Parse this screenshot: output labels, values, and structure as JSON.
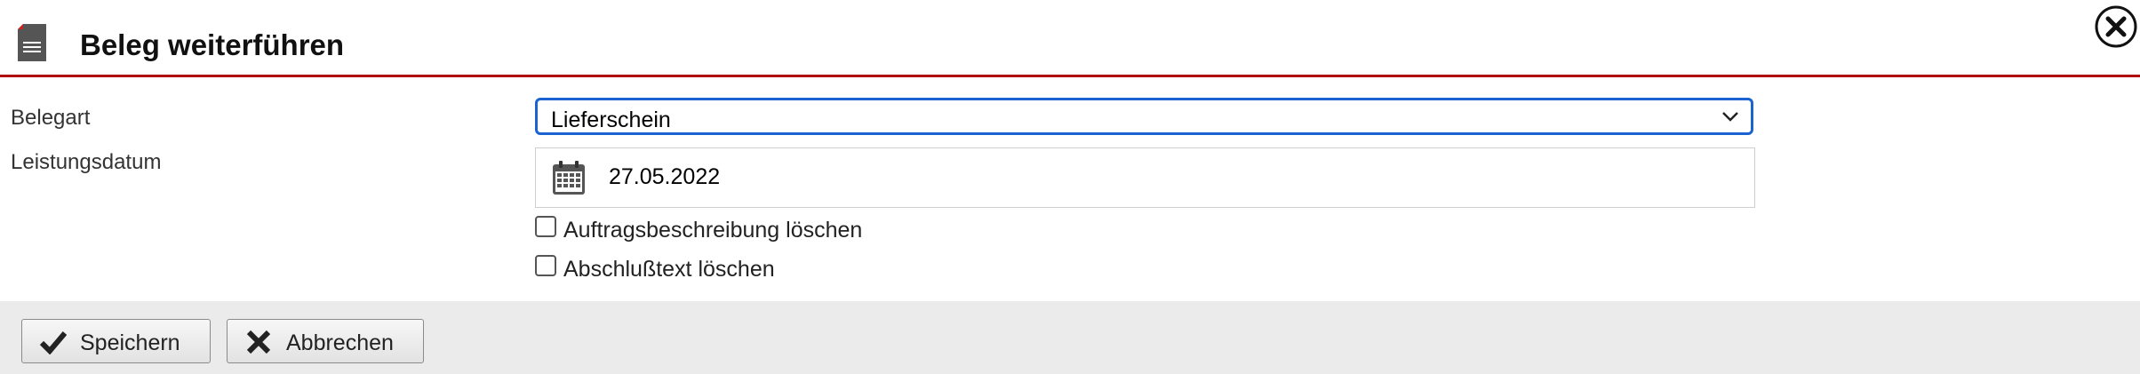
{
  "dialog": {
    "title": "Beleg weiterführen",
    "header_icon": "document-icon",
    "close_icon": "close-icon"
  },
  "form": {
    "belegart": {
      "label": "Belegart",
      "selected": "Lieferschein"
    },
    "leistungsdatum": {
      "label": "Leistungsdatum",
      "value": "27.05.2022",
      "icon": "calendar-icon"
    },
    "checkboxes": [
      {
        "label": "Auftragsbeschreibung löschen",
        "checked": false
      },
      {
        "label": "Abschlußtext löschen",
        "checked": false
      }
    ]
  },
  "footer": {
    "save_label": "Speichern",
    "save_icon": "checkmark-icon",
    "cancel_label": "Abbrechen",
    "cancel_icon": "x-icon"
  },
  "colors": {
    "accent_rule": "#b00000",
    "focus_border": "#1b63d0",
    "footer_bg": "#ebebeb"
  }
}
